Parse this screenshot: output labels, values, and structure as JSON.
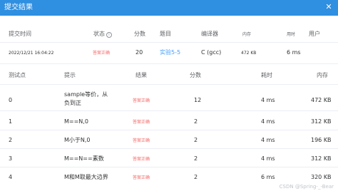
{
  "header": {
    "title": "提交结果"
  },
  "submission": {
    "headers": {
      "time": "提交时间",
      "status": "状态",
      "score": "分数",
      "problem": "题目",
      "compiler": "编译器",
      "memory": "内存",
      "runtime": "用时",
      "user": "用户"
    },
    "time": "2022/12/21 16:04:22",
    "status": "答案正确",
    "score": "20",
    "problem": "实验5-5",
    "compiler": "C (gcc)",
    "memory": "472 KB",
    "runtime": "6 ms",
    "user": ""
  },
  "tests": {
    "headers": {
      "id": "测试点",
      "hint": "提示",
      "result": "结果",
      "score": "分数",
      "time": "耗时",
      "memory": "内存"
    },
    "rows": [
      {
        "id": "0",
        "hint_line1": "sample等价，从",
        "hint_line2": "负到正",
        "result": "答案正确",
        "score": "12",
        "time": "4 ms",
        "memory": "472 KB"
      },
      {
        "id": "1",
        "hint_line1": "M==N,0",
        "hint_line2": "",
        "result": "答案正确",
        "score": "2",
        "time": "4 ms",
        "memory": "312 KB"
      },
      {
        "id": "2",
        "hint_line1": "M小于N,0",
        "hint_line2": "",
        "result": "答案正确",
        "score": "2",
        "time": "4 ms",
        "memory": "196 KB"
      },
      {
        "id": "3",
        "hint_line1": "M==N==素数",
        "hint_line2": "",
        "result": "答案正确",
        "score": "2",
        "time": "4 ms",
        "memory": "312 KB"
      },
      {
        "id": "4",
        "hint_line1": "M和M取最大边界",
        "hint_line2": "",
        "result": "答案正确",
        "score": "2",
        "time": "6 ms",
        "memory": "320 KB"
      }
    ]
  },
  "watermark": "CSDN @Spring-_-Bear"
}
